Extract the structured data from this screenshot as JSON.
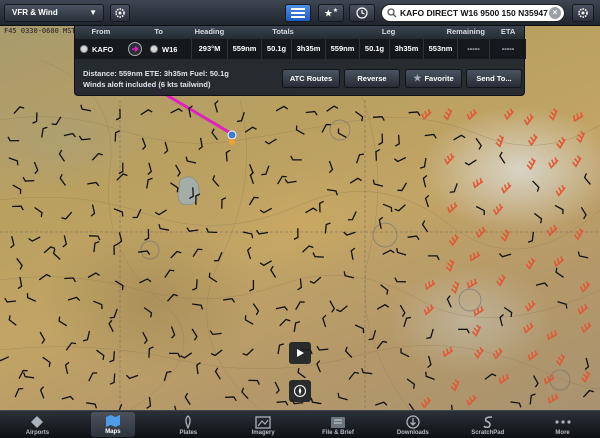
{
  "topbar": {
    "layer_select_label": "VFR & Wind",
    "search_value": "KAFO DIRECT W16 9500 150 N35947"
  },
  "map": {
    "timestamp": "F45 0330-0600 MST"
  },
  "route": {
    "headers": {
      "from": "From",
      "to": "To",
      "heading": "Heading",
      "totals": "Totals",
      "leg": "Leg",
      "remaining": "Remaining",
      "eta": "ETA"
    },
    "from": "KAFO",
    "to": "W16",
    "heading": "293°M",
    "totals": {
      "distance": "559nm",
      "fuel": "50.1g",
      "time": "3h35m"
    },
    "leg": {
      "distance": "559nm",
      "fuel": "50.1g",
      "time": "3h35m"
    },
    "remaining": {
      "distance": "553nm",
      "fuel": "-----",
      "time": "-----"
    },
    "eta": "-----",
    "summary_line1": "Distance: 559nm   ETE: 3h35m   Fuel: 50.1g",
    "summary_line2": "Winds aloft included (6 kts tailwind)",
    "buttons": {
      "atc": "ATC Routes",
      "reverse": "Reverse",
      "favorite": "Favorite",
      "send": "Send To..."
    }
  },
  "tabs": [
    {
      "label": "Airports",
      "icon": "airport-icon"
    },
    {
      "label": "Maps",
      "icon": "map-icon"
    },
    {
      "label": "Plates",
      "icon": "plates-icon"
    },
    {
      "label": "Imagery",
      "icon": "imagery-icon"
    },
    {
      "label": "File & Brief",
      "icon": "file-brief-icon"
    },
    {
      "label": "Downloads",
      "icon": "downloads-icon"
    },
    {
      "label": "ScratchPad",
      "icon": "scratchpad-icon"
    },
    {
      "label": "More",
      "icon": "more-icon"
    }
  ],
  "active_tab": "Maps",
  "colors": {
    "route_line": "#e020c0",
    "wind_arrow_fast": "#e05a3a",
    "wind_barb": "#111111",
    "active_blue": "#2d6fd8"
  }
}
